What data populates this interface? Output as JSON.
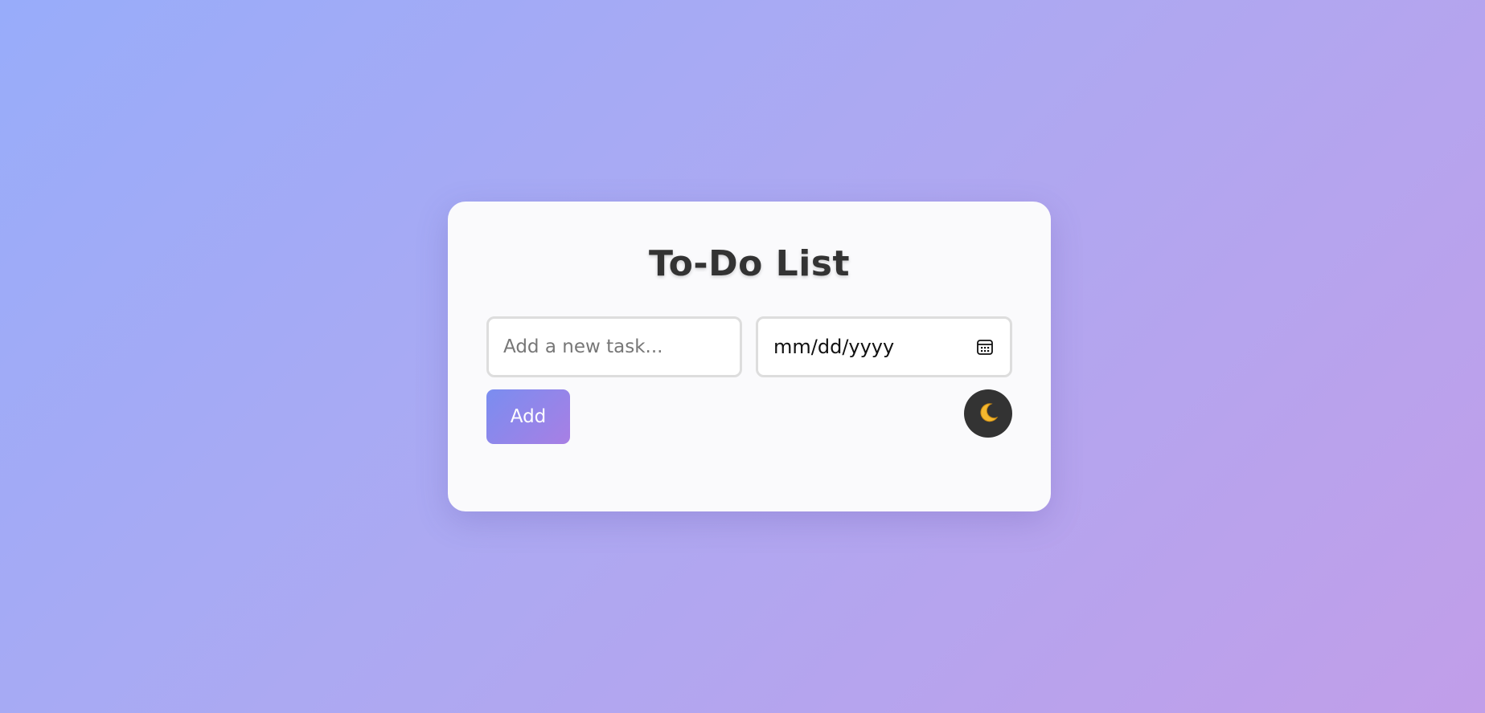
{
  "header": {
    "title": "To-Do List"
  },
  "form": {
    "task_placeholder": "Add a new task...",
    "task_value": "",
    "date_placeholder": "mm/dd/yyyy",
    "add_label": "Add"
  },
  "icons": {
    "date_picker": "calendar-icon",
    "theme_toggle": "moon-icon"
  },
  "colors": {
    "card_background": "#fafafc",
    "button_gradient_start": "#7a8df0",
    "button_gradient_end": "#a87fe4",
    "toggle_background": "#333333",
    "moon": "#f5b82e"
  }
}
